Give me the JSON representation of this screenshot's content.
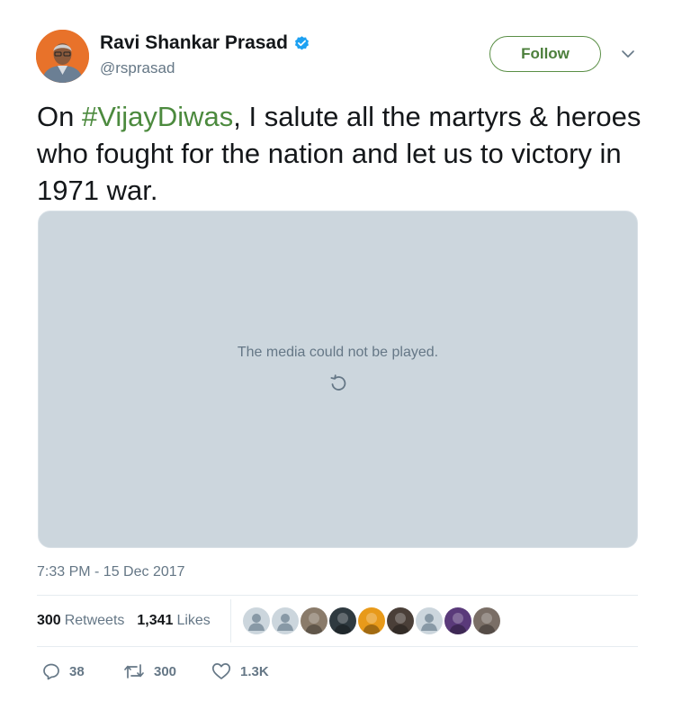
{
  "author": {
    "name": "Ravi Shankar Prasad",
    "handle": "@rsprasad",
    "verified": true
  },
  "follow_label": "Follow",
  "tweet": {
    "text_before": "On ",
    "hashtag": "#VijayDiwas",
    "text_after": ", I salute all the martyrs & heroes who fought for the nation and let us to victory in 1971 war."
  },
  "media": {
    "message": "The media could not be played."
  },
  "timestamp": "7:33 PM - 15 Dec 2017",
  "stats": {
    "retweets_count": "300",
    "retweets_label": "Retweets",
    "likes_count": "1,341",
    "likes_label": "Likes"
  },
  "actions": {
    "replies": "38",
    "retweets": "300",
    "likes": "1.3K"
  },
  "likers": [
    {
      "kind": "default"
    },
    {
      "kind": "default"
    },
    {
      "kind": "photo",
      "color": "#8a7b6a"
    },
    {
      "kind": "photo",
      "color": "#2f3a40"
    },
    {
      "kind": "photo",
      "color": "#e89a1a"
    },
    {
      "kind": "photo",
      "color": "#4a3f38"
    },
    {
      "kind": "default"
    },
    {
      "kind": "photo",
      "color": "#5a3a7a"
    },
    {
      "kind": "photo",
      "color": "#7a6e66"
    }
  ],
  "colors": {
    "accent_green": "#4c8a3e",
    "muted": "#657786",
    "media_bg": "#ccd6dd",
    "verified_blue": "#1da1f2"
  }
}
